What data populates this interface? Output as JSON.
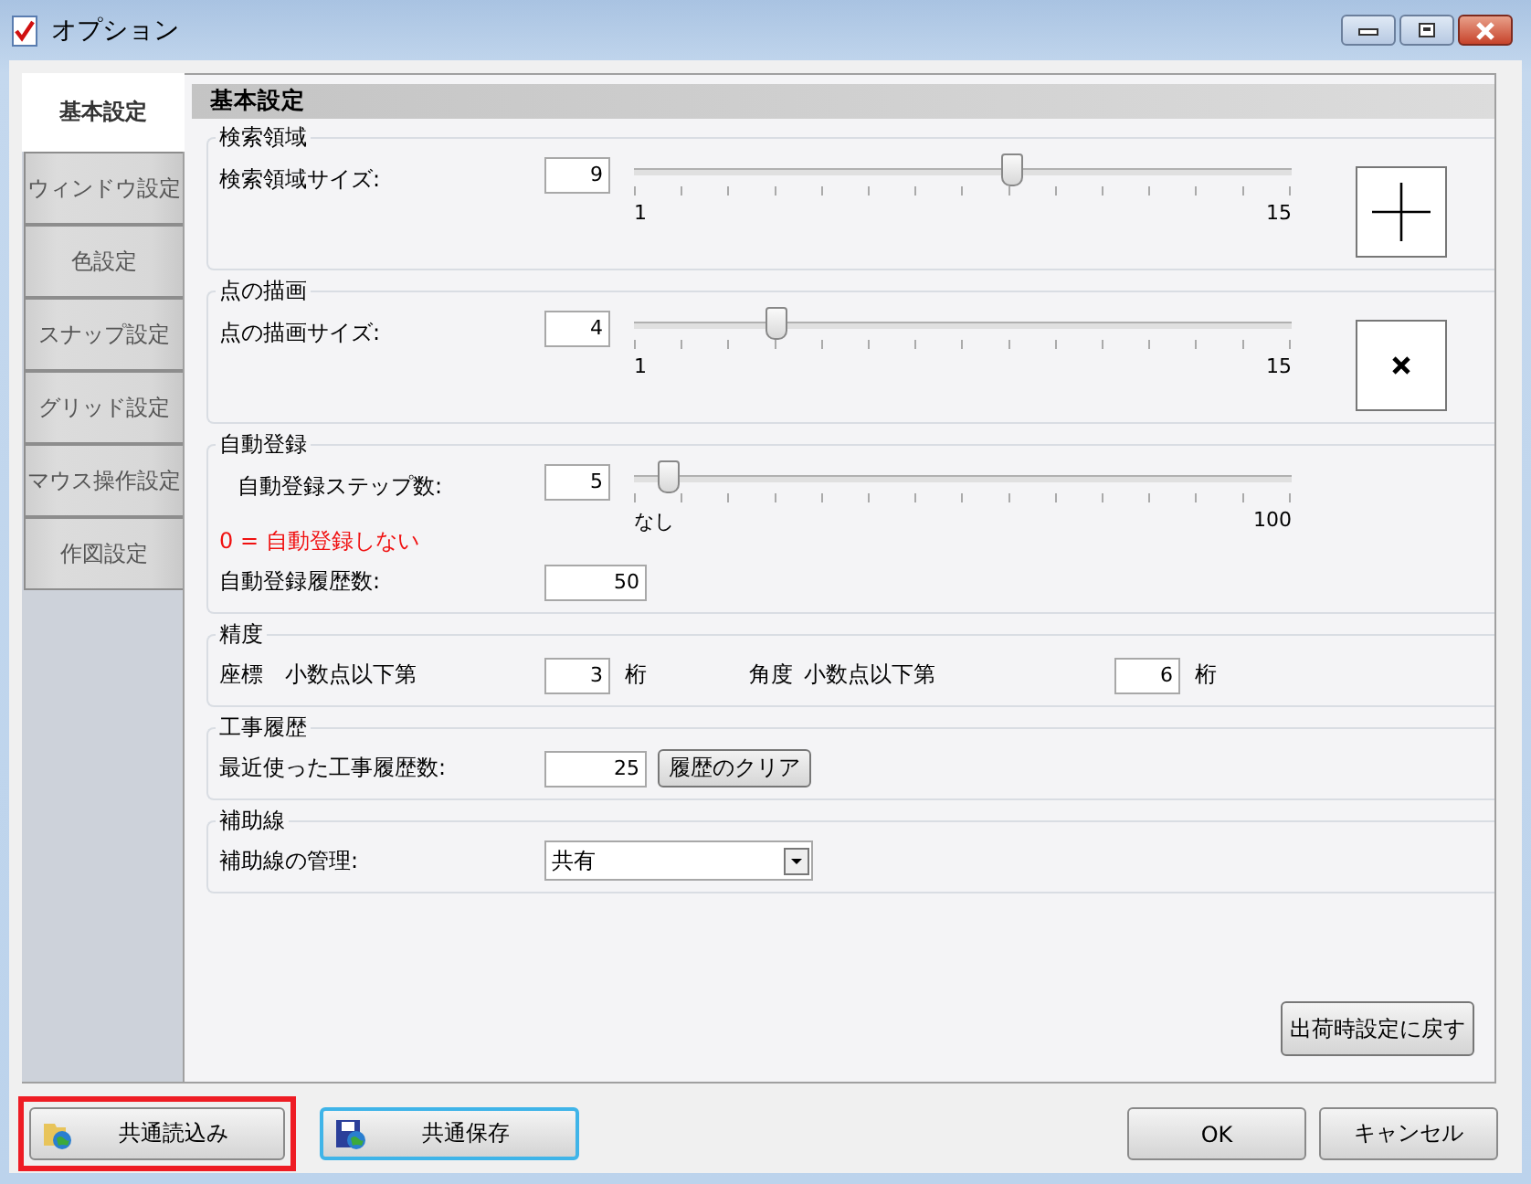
{
  "window": {
    "title": "オプション"
  },
  "tabs": [
    {
      "label": "基本設定",
      "selected": true
    },
    {
      "label": "ウィンドウ設定",
      "selected": false
    },
    {
      "label": "色設定",
      "selected": false
    },
    {
      "label": "スナップ設定",
      "selected": false
    },
    {
      "label": "グリッド設定",
      "selected": false
    },
    {
      "label": "マウス操作設定",
      "selected": false
    },
    {
      "label": "作図設定",
      "selected": false
    }
  ],
  "panel_title": "基本設定",
  "groups": [
    {
      "kind": "slider",
      "title": "検索領域",
      "label": "検索領域サイズ:",
      "value": "9",
      "level": 0.571,
      "min_label": "1",
      "max_label": "15",
      "preview": {
        "kind": "crosshair"
      }
    },
    {
      "kind": "slider",
      "title": "点の描画",
      "label": "点の描画サイズ:",
      "value": "4",
      "level": 0.214,
      "min_label": "1",
      "max_label": "15",
      "preview": {
        "kind": "x-mark"
      }
    },
    {
      "kind": "slider",
      "title": "自動登録",
      "label": "自動登録ステップ数:",
      "value": "5",
      "level": 0.05,
      "min_label": "なし",
      "max_label": "100",
      "note": "0 = 自動登録しない",
      "extra_label": "自動登録履歴数:",
      "extra_value": "50"
    },
    {
      "kind": "precision",
      "title": "精度",
      "items": [
        {
          "label": "座標",
          "sublabel": "小数点以下第",
          "value": "3",
          "unit": "桁"
        },
        {
          "label": "角度",
          "sublabel": "小数点以下第",
          "value": "6",
          "unit": "桁"
        }
      ]
    },
    {
      "kind": "history",
      "title": "工事履歴",
      "label": "最近使った工事履歴数:",
      "value": "25",
      "button": "履歴のクリア"
    },
    {
      "kind": "select",
      "title": "補助線",
      "label": "補助線の管理:",
      "value": "共有"
    }
  ],
  "reset_button": "出荷時設定に戻す",
  "bottom_buttons": [
    {
      "kind": "load",
      "label": "共通読込み",
      "highlighted": true,
      "focused": false
    },
    {
      "kind": "save",
      "label": "共通保存",
      "highlighted": false,
      "focused": true
    }
  ],
  "dialog_buttons": [
    "OK",
    "キャンセル"
  ]
}
